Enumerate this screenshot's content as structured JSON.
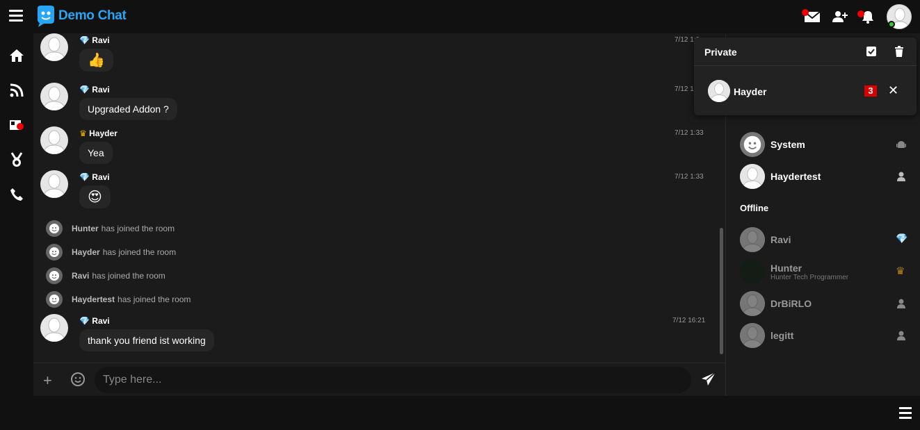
{
  "app": {
    "title": "Demo Chat",
    "brand_color": "#27a6f5"
  },
  "topbar": {
    "icons": [
      "menu-icon",
      "mail-icon",
      "add-friend-icon",
      "bell-icon"
    ],
    "user_avatar": "avatar"
  },
  "leftnav": [
    "home-icon",
    "rss-icon",
    "news-icon",
    "medal-icon",
    "phone-icon"
  ],
  "messages": [
    {
      "name": "Ravi",
      "badge": "diamond",
      "text": "👍",
      "time": "7/12 1:3"
    },
    {
      "name": "Ravi",
      "badge": "diamond",
      "text": "Upgraded Addon ?",
      "time": "7/12 1"
    },
    {
      "name": "Hayder",
      "badge": "crown",
      "text": "Yea",
      "time": "7/12 1:33"
    },
    {
      "name": "Ravi",
      "badge": "diamond",
      "text": "😍",
      "time": "7/12 1:33"
    },
    {
      "name": "Ravi",
      "badge": "diamond",
      "text": "thank you friend ist working",
      "time": "7/12 16:21"
    }
  ],
  "system": [
    {
      "name": "Hunter",
      "text": "has joined the room"
    },
    {
      "name": "Hayder",
      "text": "has joined the room"
    },
    {
      "name": "Ravi",
      "text": "has joined the room"
    },
    {
      "name": "Haydertest",
      "text": "has joined the room"
    }
  ],
  "composer": {
    "placeholder": "Type here..."
  },
  "private": {
    "title": "Private",
    "conversations": [
      {
        "name": "Hayder",
        "count": "3"
      }
    ]
  },
  "userlist": {
    "online": [
      {
        "name": "System",
        "icon": "android-icon"
      },
      {
        "name": "Haydertest",
        "icon": "user-icon"
      }
    ],
    "offline_label": "Offline",
    "offline": [
      {
        "name": "Ravi",
        "sub": "",
        "icon": "diamond-icon"
      },
      {
        "name": "Hunter",
        "sub": "Hunter Tech Programmer",
        "icon": "crown-icon"
      },
      {
        "name": "DrBiRLO",
        "sub": "",
        "icon": "user-icon"
      },
      {
        "name": "legitt",
        "sub": "",
        "icon": "user-icon"
      }
    ]
  }
}
